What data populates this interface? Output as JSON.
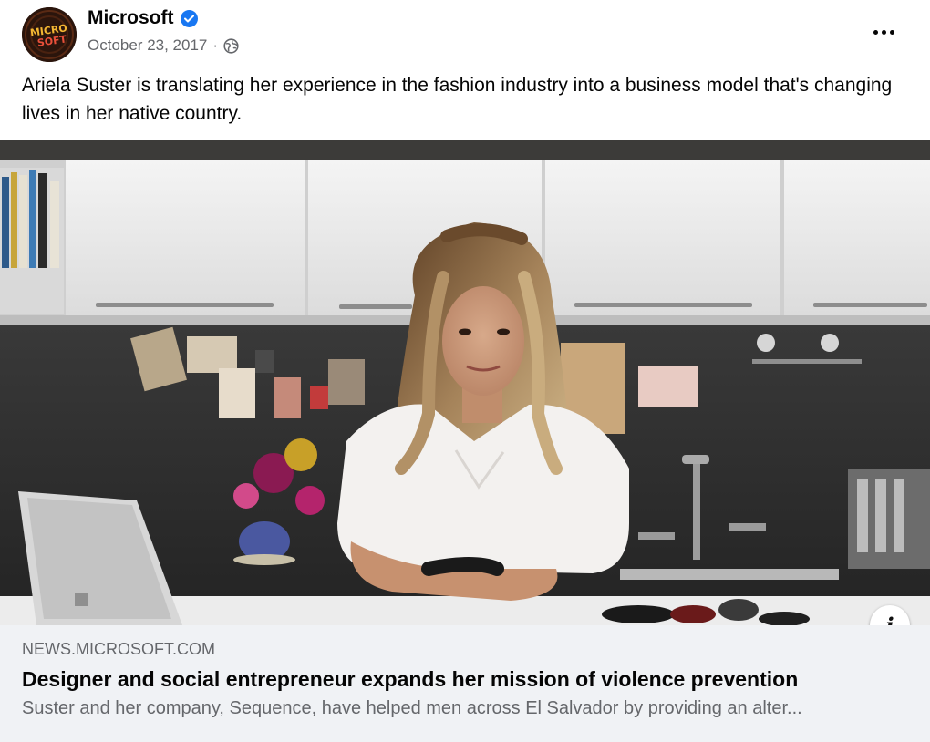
{
  "post": {
    "page_name": "Microsoft",
    "verified": true,
    "date": "October 23, 2017",
    "separator": "·",
    "audience_icon": "globe-icon",
    "avatar_text_top": "MICRO",
    "avatar_text_bottom": "SOFT",
    "caption": "Ariela Suster is translating her experience in the fashion industry into a business model that's changing lives in her native country."
  },
  "link_preview": {
    "domain": "NEWS.MICROSOFT.COM",
    "headline": "Designer and social entrepreneur expands her mission of violence prevention",
    "description": "Suster and her company, Sequence, have helped men across El Salvador by providing an alter..."
  },
  "colors": {
    "verified_blue": "#1877f2",
    "secondary_text": "#65676b",
    "link_box_bg": "#f0f2f5"
  }
}
